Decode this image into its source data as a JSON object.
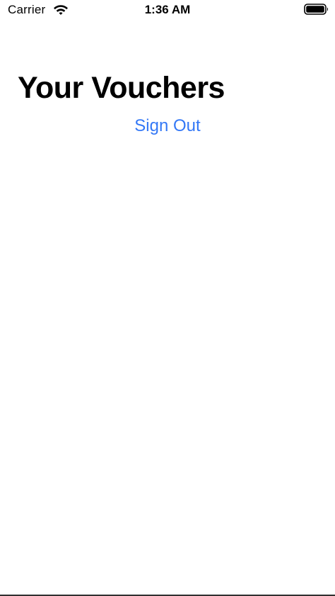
{
  "status_bar": {
    "carrier": "Carrier",
    "time": "1:36 AM",
    "wifi_icon": "wifi-icon",
    "battery_icon": "battery-full-icon"
  },
  "main": {
    "title": "Your Vouchers",
    "sign_out_label": "Sign Out"
  },
  "colors": {
    "accent": "#3478f6",
    "text": "#000000",
    "background": "#ffffff"
  }
}
